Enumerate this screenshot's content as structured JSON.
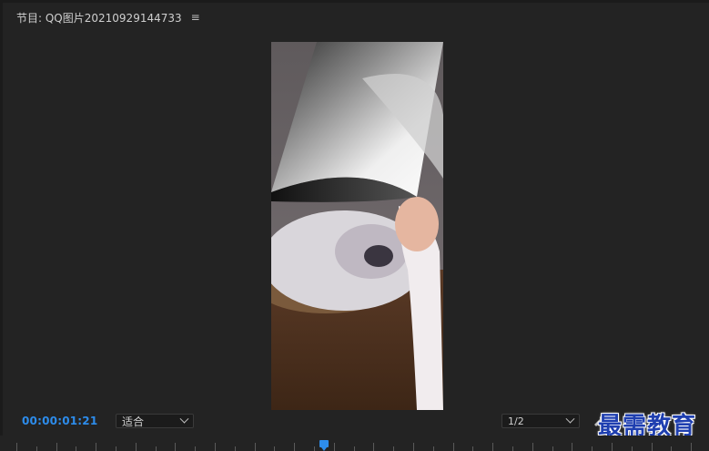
{
  "panel": {
    "title": "节目: QQ图片20210929144733",
    "menu_icon": "hamburger-menu-icon"
  },
  "playback": {
    "timecode": "00:00:01:21",
    "fit_label": "适合",
    "resolution_label": "1/2"
  },
  "watermark": {
    "text": "最需教育"
  },
  "colors": {
    "background": "#232323",
    "accent": "#2d8ceb",
    "watermark": "#1f3fb0"
  }
}
